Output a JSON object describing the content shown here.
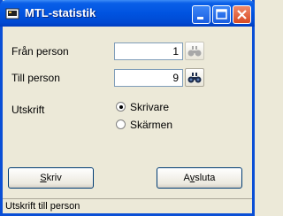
{
  "window": {
    "title": "MTL-statistik"
  },
  "form": {
    "from_label": "Från person",
    "from_value": "1",
    "to_label": "Till person",
    "to_value": "9",
    "output_label": "Utskrift",
    "options": [
      "Skrivare",
      "Skärmen"
    ],
    "selected_option": "Skrivare"
  },
  "buttons": {
    "print_first": "S",
    "print_rest": "kriv",
    "close_first": "A",
    "close_mnemonic": "v",
    "close_rest": "sluta"
  },
  "statusbar": {
    "text": "Utskrift till person"
  },
  "icons": {
    "app": "app-icon",
    "search": "binoculars-icon",
    "minimize": "minimize-icon",
    "maximize": "maximize-icon",
    "close": "close-icon"
  }
}
